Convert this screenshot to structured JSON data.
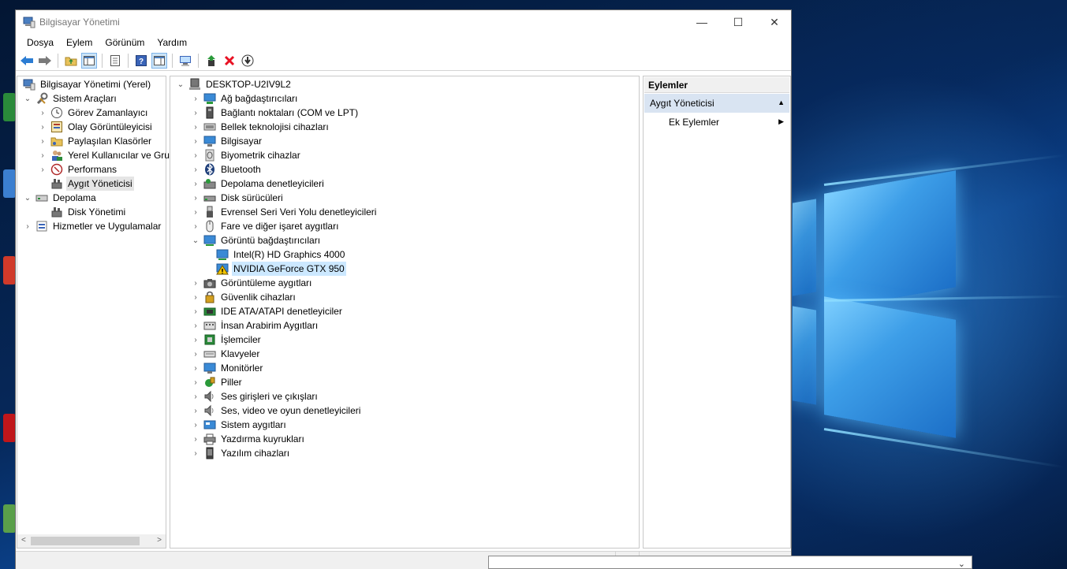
{
  "window": {
    "title": "Bilgisayar Yönetimi",
    "controls": {
      "minimize": "—",
      "maximize": "☐",
      "close": "✕"
    }
  },
  "menu": [
    "Dosya",
    "Eylem",
    "Görünüm",
    "Yardım"
  ],
  "left_tree": [
    {
      "label": "Bilgisayar Yönetimi (Yerel)",
      "icon": "computer-management-icon",
      "expander": ""
    },
    {
      "label": "Sistem Araçları",
      "icon": "system-tools-icon",
      "expander": "⌄"
    },
    {
      "label": "Görev Zamanlayıcı",
      "icon": "clock-icon",
      "expander": "›"
    },
    {
      "label": "Olay Görüntüleyicisi",
      "icon": "event-viewer-icon",
      "expander": "›"
    },
    {
      "label": "Paylaşılan Klasörler",
      "icon": "shared-folder-icon",
      "expander": "›"
    },
    {
      "label": "Yerel Kullanıcılar ve Gru",
      "icon": "users-icon",
      "expander": "›"
    },
    {
      "label": "Performans",
      "icon": "performance-icon",
      "expander": "›"
    },
    {
      "label": "Aygıt Yöneticisi",
      "icon": "device-manager-icon",
      "expander": ""
    },
    {
      "label": "Depolama",
      "icon": "storage-icon",
      "expander": "⌄"
    },
    {
      "label": "Disk Yönetimi",
      "icon": "disk-management-icon",
      "expander": ""
    },
    {
      "label": "Hizmetler ve Uygulamalar",
      "icon": "services-icon",
      "expander": "›"
    }
  ],
  "device_tree": {
    "root": "DESKTOP-U2IV9L2",
    "categories": [
      {
        "label": "Ağ bağdaştırıcıları",
        "icon": "network-adapter-icon"
      },
      {
        "label": "Bağlantı noktaları (COM ve LPT)",
        "icon": "port-icon"
      },
      {
        "label": "Bellek teknolojisi cihazları",
        "icon": "memory-icon"
      },
      {
        "label": "Bilgisayar",
        "icon": "computer-icon"
      },
      {
        "label": "Biyometrik cihazlar",
        "icon": "fingerprint-icon"
      },
      {
        "label": "Bluetooth",
        "icon": "bluetooth-icon"
      },
      {
        "label": "Depolama denetleyicileri",
        "icon": "storage-controller-icon"
      },
      {
        "label": "Disk sürücüleri",
        "icon": "disk-drive-icon"
      },
      {
        "label": "Evrensel Seri Veri Yolu denetleyicileri",
        "icon": "usb-icon"
      },
      {
        "label": "Fare ve diğer işaret aygıtları",
        "icon": "mouse-icon"
      },
      {
        "label": "Görüntü bağdaştırıcıları",
        "icon": "display-adapter-icon",
        "expanded": true,
        "children": [
          {
            "label": "Intel(R) HD Graphics 4000",
            "icon": "display-adapter-icon"
          },
          {
            "label": "NVIDIA GeForce GTX 950",
            "icon": "warning-icon"
          }
        ]
      },
      {
        "label": "Görüntüleme aygıtları",
        "icon": "camera-icon"
      },
      {
        "label": "Güvenlik cihazları",
        "icon": "security-device-icon"
      },
      {
        "label": "IDE ATA/ATAPI denetleyiciler",
        "icon": "ide-icon"
      },
      {
        "label": "İnsan Arabirim Aygıtları",
        "icon": "hid-icon"
      },
      {
        "label": "İşlemciler",
        "icon": "processor-icon"
      },
      {
        "label": "Klavyeler",
        "icon": "keyboard-icon"
      },
      {
        "label": "Monitörler",
        "icon": "monitor-icon"
      },
      {
        "label": "Piller",
        "icon": "battery-icon"
      },
      {
        "label": "Ses girişleri ve çıkışları",
        "icon": "speaker-icon"
      },
      {
        "label": "Ses, video ve oyun denetleyicileri",
        "icon": "sound-icon"
      },
      {
        "label": "Sistem aygıtları",
        "icon": "system-device-icon"
      },
      {
        "label": "Yazdırma kuyrukları",
        "icon": "printer-icon"
      },
      {
        "label": "Yazılım cihazları",
        "icon": "software-device-icon"
      }
    ]
  },
  "actions": {
    "header": "Eylemler",
    "section": "Aygıt Yöneticisi",
    "more": "Ek Eylemler"
  },
  "colors": {
    "selection_gray": "#e5e5e5",
    "selection_blue": "#cce8ff",
    "actions_section_bg": "#d9e4f2",
    "delete_red": "#e81123",
    "back_arrow_blue": "#2b7cd3",
    "warning_yellow": "#f2c500"
  }
}
